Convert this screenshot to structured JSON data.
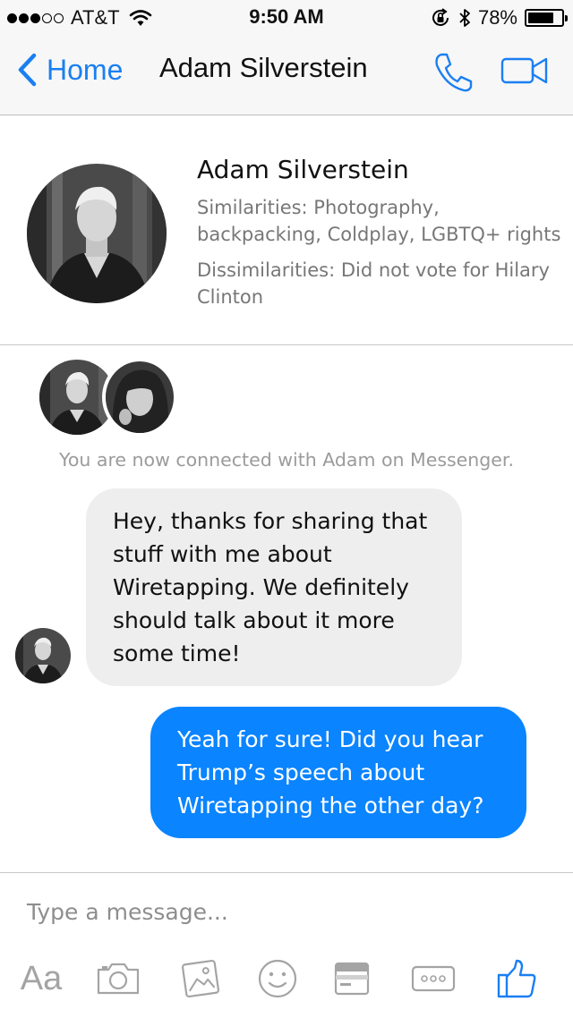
{
  "status_bar": {
    "carrier": "AT&T",
    "time": "9:50 AM",
    "battery": "78%",
    "battery_level": 0.78,
    "signal_bars_filled": 3,
    "signal_bars_total": 5
  },
  "nav": {
    "back_label": "Home",
    "title": "Adam Silverstein",
    "accent_color": "#1a7ff2"
  },
  "profile": {
    "name": "Adam Silverstein",
    "similarities": "Similarities: Photography, backpacking, Coldplay, LGBTQ+ rights",
    "dissimilarities": "Dissimilarities: Did not vote for Hilary Clinton"
  },
  "conversation": {
    "connected_note": "You are now connected with Adam on Messenger.",
    "messages": [
      {
        "from": "Adam",
        "text": "Hey, thanks for sharing that stuff with me about Wiretapping. We definitely should talk about it more some time!"
      },
      {
        "from": "me",
        "text": "Yeah for sure! Did you hear Trump’s speech about Wiretapping the other day?"
      }
    ],
    "outgoing_color": "#0a84ff",
    "incoming_color": "#eeeeee"
  },
  "composer": {
    "placeholder": "Type a message...",
    "tools": [
      {
        "label": "Aa",
        "icon": "text-format-icon"
      },
      {
        "icon": "camera-icon"
      },
      {
        "icon": "photo-gallery-icon"
      },
      {
        "icon": "emoji-icon"
      },
      {
        "icon": "sticker-card-icon"
      },
      {
        "icon": "more-icon"
      },
      {
        "icon": "thumbs-up-icon"
      }
    ]
  }
}
